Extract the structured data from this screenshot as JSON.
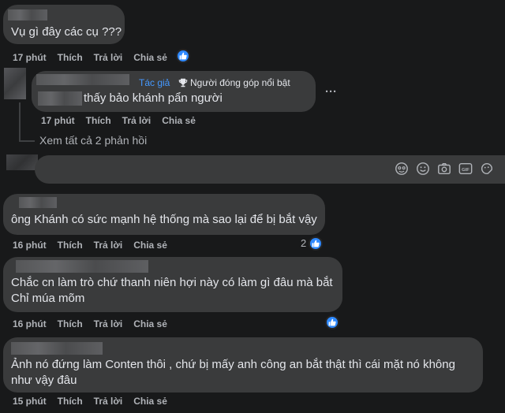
{
  "comments": [
    {
      "text": "Vụ gì đây các cụ ???",
      "time": "17 phút",
      "like": "Thích",
      "reply": "Trả lời",
      "share": "Chia sẻ"
    },
    {
      "author_badge": "Tác giả",
      "contributor_badge": "Người đóng góp nổi bật",
      "text": "thấy bảo khánh pẩn người",
      "time": "17 phút",
      "like": "Thích",
      "reply": "Trả lời",
      "share": "Chia sẻ",
      "more": "···"
    },
    {
      "text": "ông Khánh có sức mạnh hệ thống mà sao lại để bị bắt vậy",
      "time": "16 phút",
      "like": "Thích",
      "reply": "Trả lời",
      "share": "Chia sẻ",
      "reaction_count": "2"
    },
    {
      "text_line1": "Chắc cn làm trò chứ thanh niên hợi này có làm gì đâu mà bắt",
      "text_line2": "Chỉ múa mõm",
      "time": "16 phút",
      "like": "Thích",
      "reply": "Trả lời",
      "share": "Chia sẻ"
    },
    {
      "text_line1": "Ảnh nó đứng làm Conten thôi , chứ bị mấy anh công an bắt thật thì cái mặt nó không",
      "text_line2": "như vậy đâu",
      "time": "15 phút",
      "like": "Thích",
      "reply": "Trả lời",
      "share": "Chia sẻ"
    }
  ],
  "view_replies": "Xem tất cả 2 phản hồi",
  "reply_input_icons": [
    "avatar-sticker-icon",
    "emoji-icon",
    "camera-icon",
    "gif-icon",
    "sticker-icon"
  ],
  "colors": {
    "background": "#18191a",
    "bubble": "#3a3b3c",
    "text": "#e4e6eb",
    "secondary": "#b0b3b8",
    "accent": "#2e89ff"
  }
}
